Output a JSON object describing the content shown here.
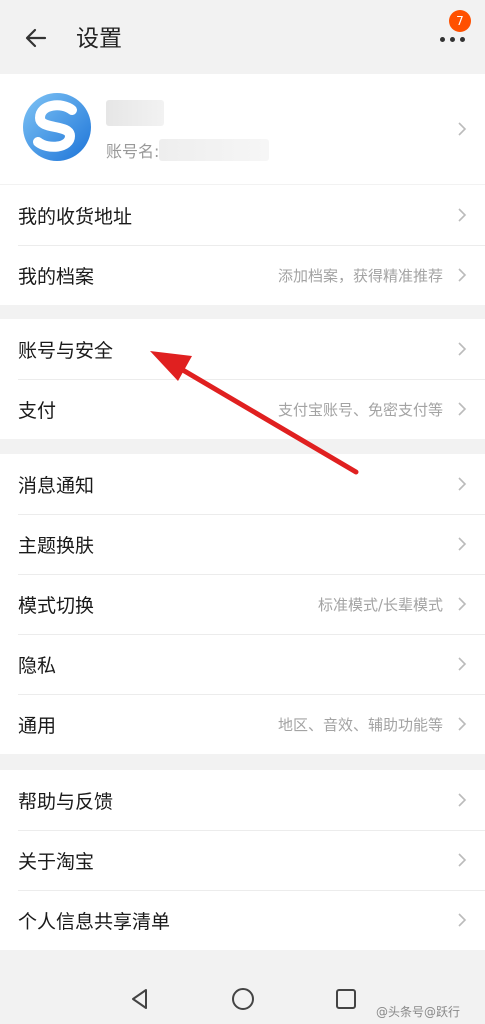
{
  "header": {
    "title": "设置",
    "back_icon": "arrow-left-icon",
    "more_icon": "more-dots-icon",
    "badge_count": "7"
  },
  "profile": {
    "account_label": "账号名:"
  },
  "sections": [
    {
      "items": [
        {
          "label": "我的收货地址",
          "sub": ""
        },
        {
          "label": "我的档案",
          "sub": "添加档案，获得精准推荐"
        }
      ]
    },
    {
      "items": [
        {
          "label": "账号与安全",
          "sub": ""
        },
        {
          "label": "支付",
          "sub": "支付宝账号、免密支付等"
        }
      ]
    },
    {
      "items": [
        {
          "label": "消息通知",
          "sub": ""
        },
        {
          "label": "主题换肤",
          "sub": ""
        },
        {
          "label": "模式切换",
          "sub": "标准模式/长辈模式"
        },
        {
          "label": "隐私",
          "sub": ""
        },
        {
          "label": "通用",
          "sub": "地区、音效、辅助功能等"
        }
      ]
    },
    {
      "items": [
        {
          "label": "帮助与反馈",
          "sub": ""
        },
        {
          "label": "关于淘宝",
          "sub": ""
        },
        {
          "label": "个人信息共享清单",
          "sub": ""
        }
      ]
    }
  ],
  "navbar": {
    "back_icon": "nav-back-icon",
    "home_icon": "nav-home-icon",
    "recents_icon": "nav-recents-icon"
  },
  "watermark": "@头条号@跃行",
  "colors": {
    "badge": "#ff5000",
    "annotation_arrow": "#e02020",
    "background": "#f2f2f2"
  }
}
